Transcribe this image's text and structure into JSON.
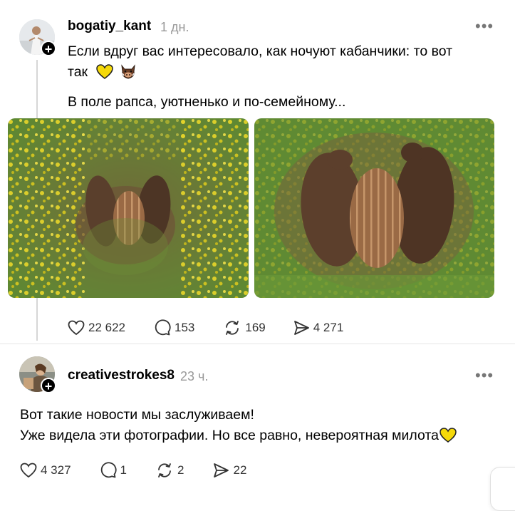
{
  "post1": {
    "username": "bogatiy_kant",
    "time": "1 дн.",
    "more_label": "•••",
    "text_line1": "Если вдруг вас интересовало, как ночуют кабанчики: то вот",
    "text_line2": "так",
    "text_line3": "В поле рапса, уютненько и по-семейному...",
    "emojis": [
      "yellow-heart",
      "boar"
    ],
    "images": [
      "photo-boars-1",
      "photo-boars-2"
    ],
    "stats": {
      "likes": "22 622",
      "comments": "153",
      "reposts": "169",
      "shares": "4 271"
    }
  },
  "post2": {
    "username": "creativestrokes8",
    "time": "23 ч.",
    "more_label": "•••",
    "text_line1": "Вот такие новости мы заслуживаем!",
    "text_line2": "Уже видела эти фотографии. Но все равно, невероятная милота",
    "emojis": [
      "yellow-heart"
    ],
    "stats": {
      "likes": "4 327",
      "comments": "1",
      "reposts": "2",
      "shares": "22"
    }
  },
  "colors": {
    "text": "#000000",
    "muted": "#999999",
    "icon": "#333333",
    "heart": "#f5d90a",
    "field_green": "#6f8f3a",
    "rapeseed_yellow": "#e3d22a"
  }
}
